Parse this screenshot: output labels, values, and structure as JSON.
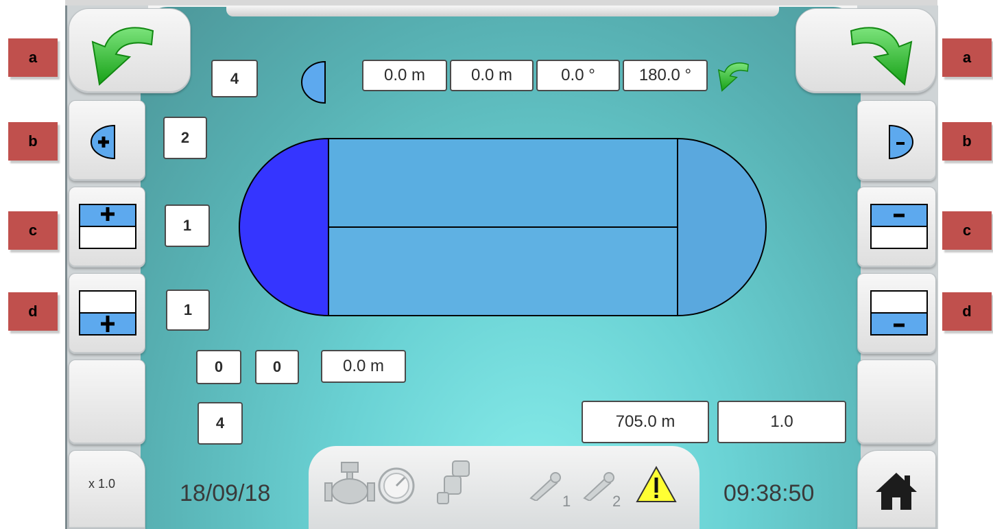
{
  "side_labels": {
    "left": [
      "a",
      "b",
      "c",
      "d"
    ],
    "right": [
      "a",
      "b",
      "c",
      "d"
    ]
  },
  "indicators": {
    "top_count": "4",
    "count_b": "2",
    "count_c": "1",
    "count_d": "1",
    "bottom_count": "4",
    "pair_left": "0",
    "pair_right": "0"
  },
  "measurements": {
    "x": "0.0 m",
    "y": "0.0 m",
    "angle1": "0.0 °",
    "angle2": "180.0 °",
    "offset": "0.0 m",
    "distance": "705.0 m",
    "factor": "1.0"
  },
  "footer": {
    "zoom": "x 1.0",
    "date": "18/09/18",
    "time": "09:38:50",
    "sensor1": "1",
    "sensor2": "2"
  },
  "icons": {
    "rotate_left": "rotate-left-arrow",
    "rotate_right": "rotate-right-arrow",
    "home": "home-icon",
    "warning": "warning-icon",
    "valve": "valve-icon",
    "gauge": "gauge-icon",
    "pump": "pump-icon"
  },
  "colors": {
    "label_red": "#c0504d",
    "field_light_blue": "#5dafe0",
    "field_dark_blue": "#3535ff",
    "arrow_green": "#2fbf2f"
  }
}
